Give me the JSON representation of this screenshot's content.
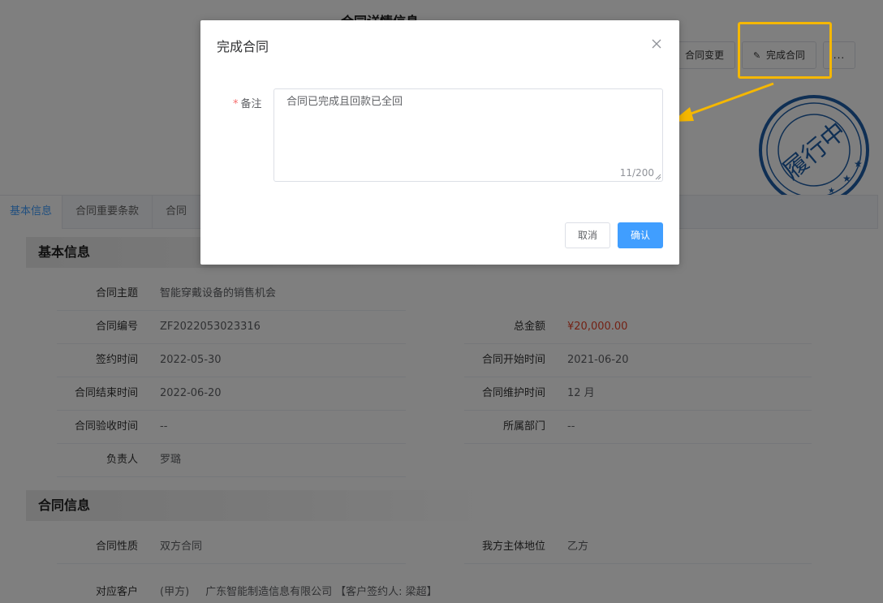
{
  "header": {
    "title": "合同详情信息"
  },
  "actions": {
    "change_label": "合同变更",
    "complete_label": "完成合同",
    "more_label": "..."
  },
  "stamp": {
    "text": "履行中",
    "color": "#1f5fa8"
  },
  "tabs": [
    {
      "label": "基本信息",
      "active": true
    },
    {
      "label": "合同重要条款",
      "active": false
    },
    {
      "label": "合同",
      "active": false
    }
  ],
  "sections": {
    "basic_title": "基本信息",
    "contract_title": "合同信息"
  },
  "basic_info": {
    "subject": {
      "label": "合同主题",
      "value": "智能穿戴设备的销售机会"
    },
    "number": {
      "label": "合同编号",
      "value": "ZF2022053023316"
    },
    "amount": {
      "label": "总金额",
      "value": "¥20,000.00"
    },
    "sign_date": {
      "label": "签约时间",
      "value": "2022-05-30"
    },
    "start_date": {
      "label": "合同开始时间",
      "value": "2021-06-20"
    },
    "end_date": {
      "label": "合同结束时间",
      "value": "2022-06-20"
    },
    "maintain": {
      "label": "合同维护时间",
      "value": "12 月"
    },
    "accept_date": {
      "label": "合同验收时间",
      "value": "--"
    },
    "department": {
      "label": "所属部门",
      "value": "--"
    },
    "owner": {
      "label": "负责人",
      "value": "罗璐"
    }
  },
  "contract_info": {
    "nature": {
      "label": "合同性质",
      "value": "双方合同"
    },
    "our_role": {
      "label": "我方主体地位",
      "value": "乙方"
    },
    "customer": {
      "label": "对应客户",
      "party": "(甲方)",
      "company": "广东智能制造信息有限公司",
      "signer": "【客户签约人: 梁超】"
    }
  },
  "dialog": {
    "title": "完成合同",
    "remark_label": "备注",
    "required_mark": "*",
    "remark_value": "合同已完成且回款已全回",
    "counter": "11/200",
    "cancel_label": "取消",
    "confirm_label": "确认"
  },
  "colors": {
    "primary": "#409eff",
    "highlight": "#f5b700",
    "money": "#e6452a",
    "required": "#f56c6c"
  }
}
